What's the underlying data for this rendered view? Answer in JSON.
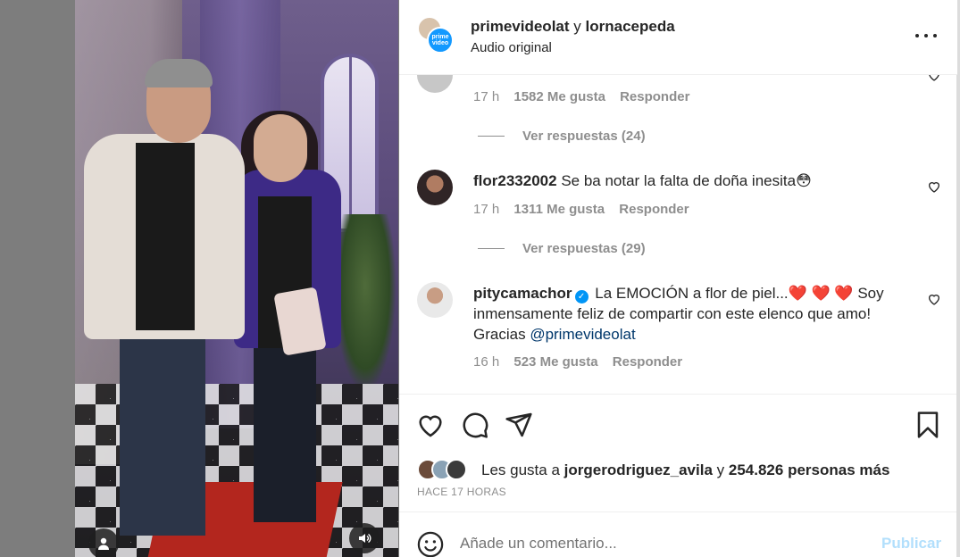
{
  "header": {
    "user1": "primevideolat",
    "connector": "y",
    "user2": "lornacepeda",
    "audio": "Audio original",
    "avatar_logo": "prime video"
  },
  "comments": [
    {
      "id": "partial",
      "time": "17 h",
      "likes": "1582 Me gusta",
      "reply": "Responder",
      "view_replies": "Ver respuestas (24)"
    },
    {
      "id": "flor",
      "username": "flor2332002",
      "text": "Se ba notar la falta de doña inesita",
      "emoji": "😳",
      "time": "17 h",
      "likes": "1311 Me gusta",
      "reply": "Responder",
      "view_replies": "Ver respuestas (29)"
    },
    {
      "id": "pity",
      "username": "pitycamachor",
      "text_before": "La EMOCIÓN a flor de piel...",
      "hearts": "❤️ ❤️ ❤️",
      "text_after": "Soy inmensamente feliz de compartir con este elenco que amo! Gracias",
      "mention": "@primevideolat",
      "time": "16 h",
      "likes": "523 Me gusta",
      "reply": "Responder"
    }
  ],
  "likes": {
    "prefix": "Les gusta a",
    "user": "jorgerodriguez_avila",
    "connector": "y",
    "count": "254.826 personas más",
    "time_ago": "HACE 17 HORAS"
  },
  "add_comment": {
    "placeholder": "Añade un comentario...",
    "publish": "Publicar"
  },
  "colors": {
    "link_blue": "#00376b",
    "verified_blue": "#0095f6",
    "publish_disabled": "#b2dffc",
    "muted_text": "#8e8e8e"
  },
  "icons": [
    "user-tag-icon",
    "speaker-icon",
    "more-icon",
    "heart-icon",
    "comment-icon",
    "share-icon",
    "bookmark-icon",
    "emoji-icon",
    "verified-icon"
  ]
}
